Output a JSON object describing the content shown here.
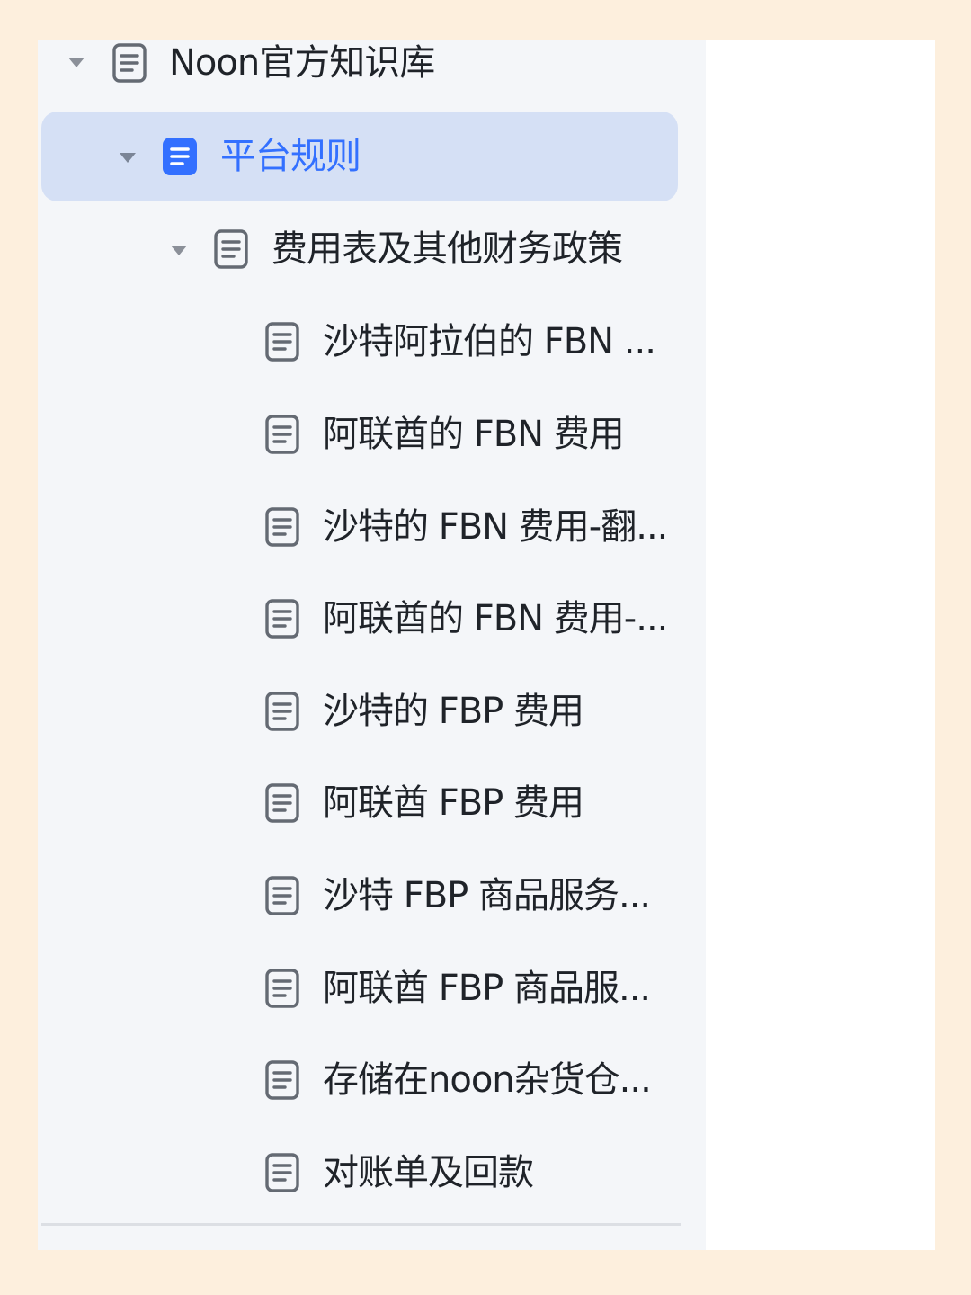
{
  "tree": {
    "root": {
      "label": "Noon官方知识库",
      "icon": "doc-outline-icon",
      "expanded": true
    },
    "section": {
      "label": "平台规则",
      "icon": "doc-filled-icon",
      "expanded": true,
      "selected": true,
      "accent_color": "#3370ff",
      "highlight_color": "#d5e0f5"
    },
    "subsection": {
      "label": "费用表及其他财务政策",
      "icon": "doc-outline-icon",
      "expanded": true
    },
    "pages": [
      {
        "label": "沙特阿拉伯的 FBN ..."
      },
      {
        "label": "阿联酋的 FBN 费用"
      },
      {
        "label": "沙特的 FBN 费用-翻..."
      },
      {
        "label": "阿联酋的 FBN 费用-..."
      },
      {
        "label": "沙特的 FBP 费用"
      },
      {
        "label": "阿联酋 FBP 费用"
      },
      {
        "label": "沙特 FBP 商品服务..."
      },
      {
        "label": "阿联酋 FBP 商品服..."
      },
      {
        "label": "存储在noon杂货仓..."
      },
      {
        "label": "对账单及回款"
      }
    ]
  }
}
